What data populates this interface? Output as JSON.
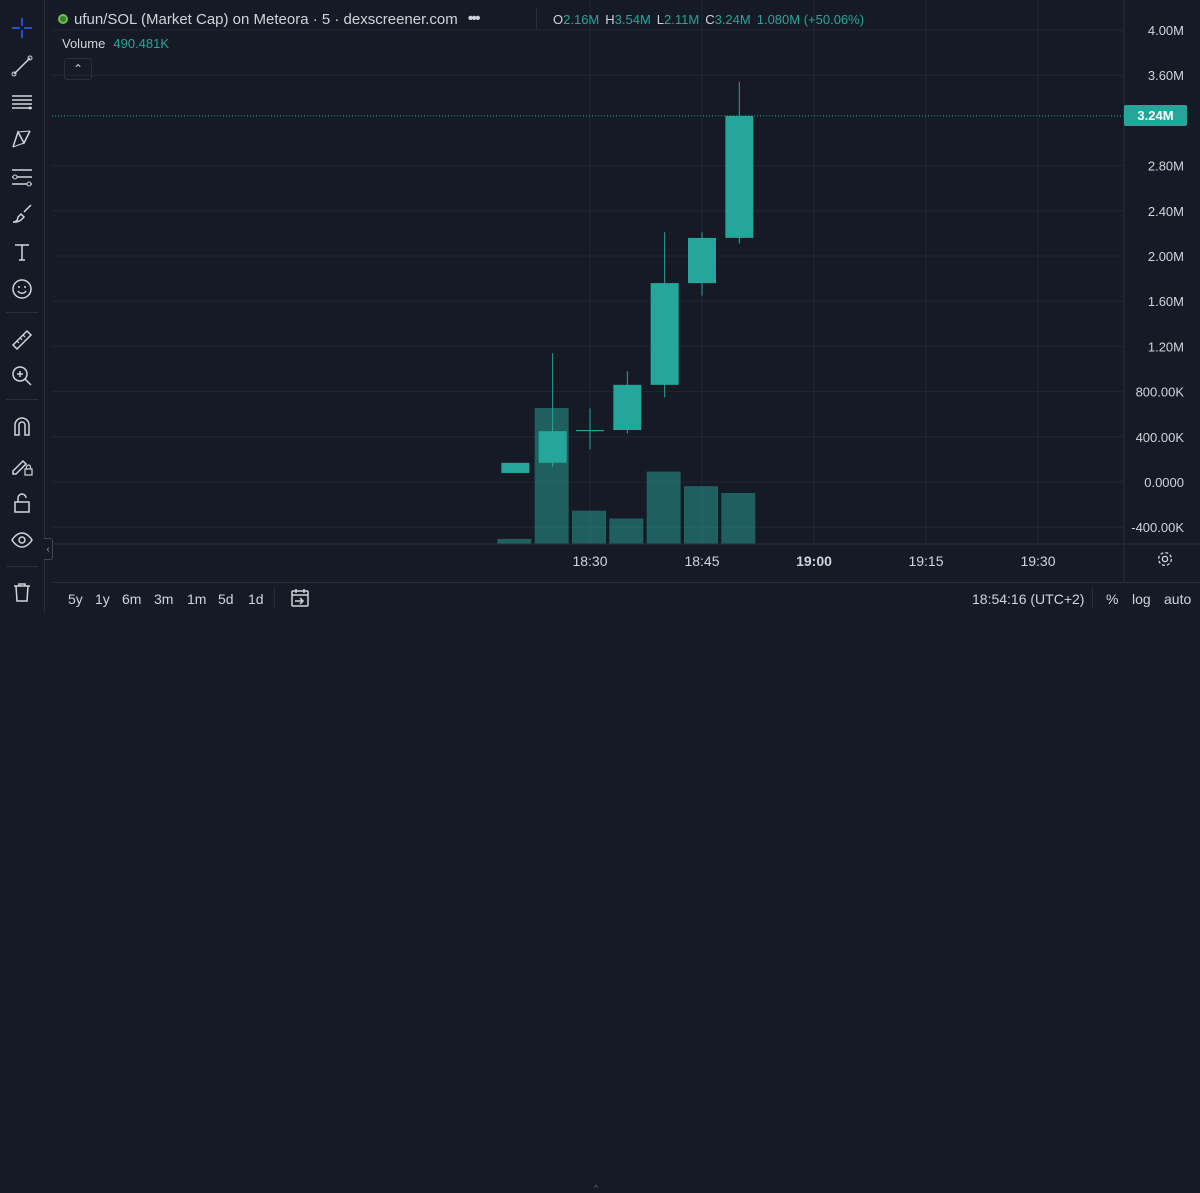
{
  "legend": {
    "title": "ufun/SOL (Market Cap) on Meteora · 5 · dexscreener.com",
    "ohlc": {
      "o_label": "O",
      "o_value": "2.16M",
      "h_label": "H",
      "h_value": "3.54M",
      "l_label": "L",
      "l_value": "2.11M",
      "c_label": "C",
      "c_value": "3.24M",
      "change": "1.080M (+50.06%)"
    },
    "volume_label": "Volume",
    "volume_value": "490.481K",
    "hide_indicator_glyph": "⌃"
  },
  "price_tag": "3.24M",
  "colors": {
    "up": "#26a69a",
    "background": "#161a25",
    "grid": "#232632"
  },
  "toolbar": {
    "icons": [
      "crosshair-icon",
      "trend-line-icon",
      "horizontal-lines-icon",
      "pattern-icon",
      "fib-icon",
      "brush-icon",
      "text-icon",
      "emoji-icon",
      "ruler-icon",
      "zoom-in-icon",
      "magnet-icon",
      "lock-drawing-icon",
      "lock-icon",
      "eye-icon",
      "trash-icon"
    ]
  },
  "bottom": {
    "ranges": [
      "5y",
      "1y",
      "6m",
      "3m",
      "1m",
      "5d",
      "1d"
    ],
    "clock": "18:54:16 (UTC+2)",
    "percent": "%",
    "log": "log",
    "auto": "auto"
  },
  "chart_data": {
    "type": "candlestick",
    "price_axis_labels": [
      "4.00M",
      "3.60M",
      "3.24M",
      "2.80M",
      "2.40M",
      "2.00M",
      "1.60M",
      "1.20M",
      "800.00K",
      "400.00K",
      "0.0000",
      "-400.00K"
    ],
    "time_axis_labels": [
      "18:30",
      "18:45",
      "19:00",
      "19:15",
      "19:30"
    ],
    "ylim": [
      -500000,
      4000000
    ],
    "candles": [
      {
        "time": "18:20",
        "open": 170000,
        "high": 170000,
        "low": 80000,
        "close": 80000
      },
      {
        "time": "18:25",
        "open": 170000,
        "high": 1140000,
        "low": 130000,
        "close": 450000
      },
      {
        "time": "18:30",
        "open": 450000,
        "high": 650000,
        "low": 290000,
        "close": 460000
      },
      {
        "time": "18:35",
        "open": 460000,
        "high": 980000,
        "low": 430000,
        "close": 860000
      },
      {
        "time": "18:40",
        "open": 860000,
        "high": 2210000,
        "low": 750000,
        "close": 1760000
      },
      {
        "time": "18:45",
        "open": 1760000,
        "high": 2210000,
        "low": 1650000,
        "close": 2160000
      },
      {
        "time": "18:50",
        "open": 2160000,
        "high": 3540000,
        "low": 2110000,
        "close": 3240000
      }
    ],
    "volume": [
      {
        "time": "18:20",
        "value": 15000
      },
      {
        "time": "18:25",
        "value": 400000
      },
      {
        "time": "18:30",
        "value": 98000
      },
      {
        "time": "18:35",
        "value": 75000
      },
      {
        "time": "18:40",
        "value": 213000
      },
      {
        "time": "18:45",
        "value": 170000
      },
      {
        "time": "18:50",
        "value": 150000
      }
    ],
    "last_price": 3240000,
    "grid": true
  }
}
